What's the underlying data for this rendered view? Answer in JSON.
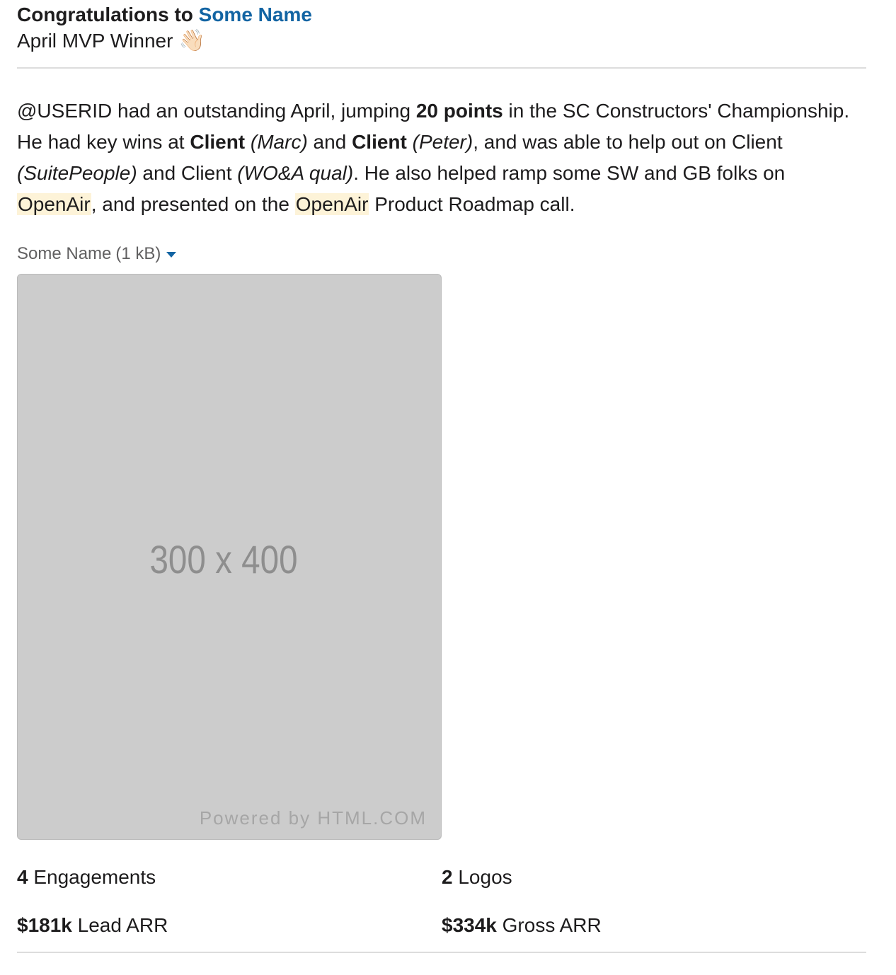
{
  "header": {
    "prefix": "Congratulations to ",
    "name": "Some Name",
    "subtitle": "April MVP Winner",
    "emoji": "👋🏻"
  },
  "message": {
    "t1": "@USERID had an outstanding April, jumping ",
    "b1": "20 points",
    "t2": " in the SC Constructors' Championship. He had key wins at ",
    "b2": "Client",
    "i1": "(Marc)",
    "t3": " and ",
    "b3": "Client",
    "i2": "(Peter)",
    "t4": ", and was able to help out on Client ",
    "i3": "(SuitePeople)",
    "t5": " and Client ",
    "i4": "(WO&A qual)",
    "t6": ". He also helped ramp some SW and GB folks on ",
    "h1": "OpenAir",
    "t7": ", and presented on the ",
    "h2": "OpenAir",
    "t8": " Product Roadmap call."
  },
  "attachment": {
    "name": "Some Name",
    "size": "(1 kB)",
    "image_label": "300 x 400",
    "image_credit": "Powered by HTML.COM"
  },
  "stats": [
    {
      "value": "4",
      "label": " Engagements"
    },
    {
      "value": "2",
      "label": " Logos"
    },
    {
      "value": "$181k",
      "label": " Lead ARR"
    },
    {
      "value": "$334k",
      "label": " Gross ARR"
    }
  ]
}
